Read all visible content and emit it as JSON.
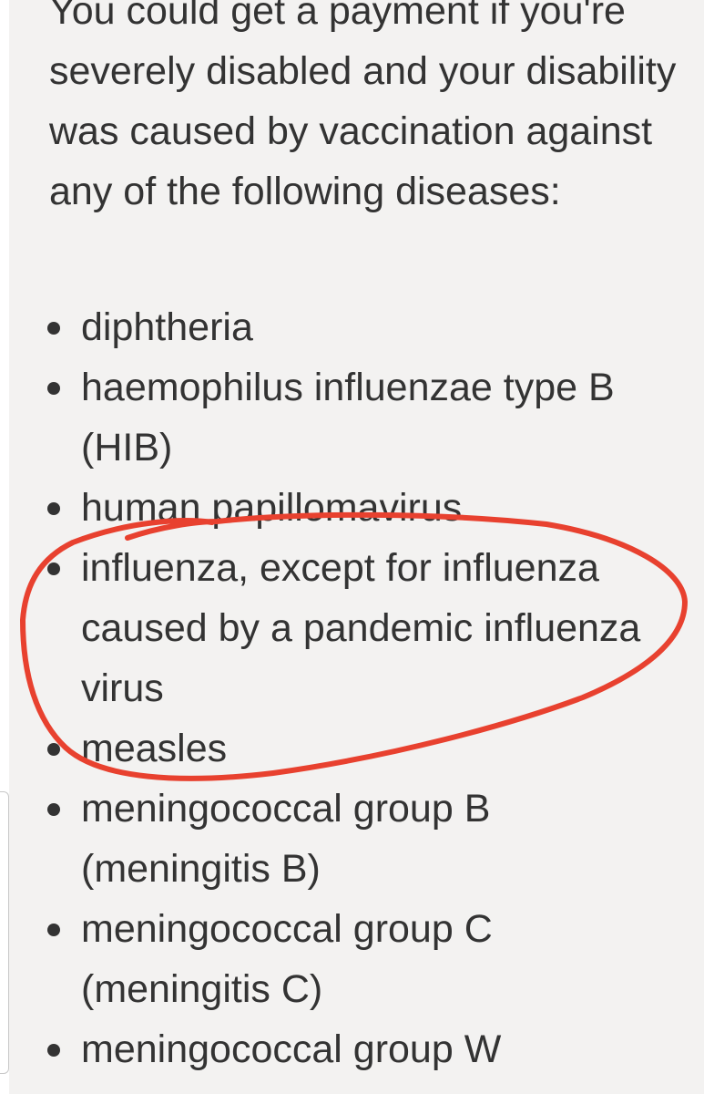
{
  "intro_text": "You could get a payment if you're severely disabled and your disability was caused by vaccination against any of the following diseases:",
  "diseases": [
    "diphtheria",
    "haemophilus influenzae type B (HIB)",
    "human papillomavirus",
    "influenza, except for influenza caused by a pandemic influenza virus",
    "measles",
    "meningococcal group B (meningitis B)",
    "meningococcal group C (meningitis C)",
    "meningococcal group W (meningitis W)"
  ],
  "annotation": {
    "color": "#e8412f",
    "circled_item": "influenza, except for influenza caused by a pandemic influenza virus"
  }
}
